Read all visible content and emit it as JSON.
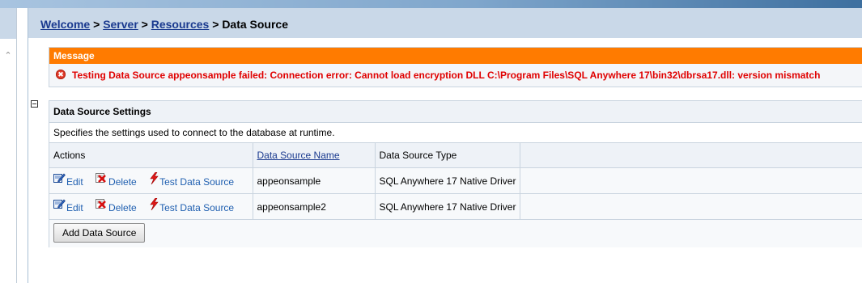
{
  "breadcrumb": {
    "items": [
      "Welcome",
      "Server",
      "Resources"
    ],
    "separator": ">",
    "current": "Data Source"
  },
  "message": {
    "header": "Message",
    "icon": "error-icon",
    "text": "Testing Data Source appeonsample failed: Connection error: Cannot load encryption DLL C:\\Program Files\\SQL Anywhere 17\\bin32\\dbrsa17.dll: version mismatch",
    "color": "#e00000",
    "header_color": "#ff7b00"
  },
  "settings": {
    "title": "Data Source Settings",
    "description": "Specifies the settings used to connect to the database at runtime.",
    "columns": [
      "Actions",
      "Data Source Name",
      "Data Source Type"
    ],
    "actions": [
      "Edit",
      "Delete",
      "Test Data Source"
    ],
    "rows": [
      {
        "name": "appeonsample",
        "type": "SQL Anywhere 17 Native Driver"
      },
      {
        "name": "appeonsample2",
        "type": "SQL Anywhere 17 Native Driver"
      }
    ],
    "add_button": "Add Data Source"
  }
}
